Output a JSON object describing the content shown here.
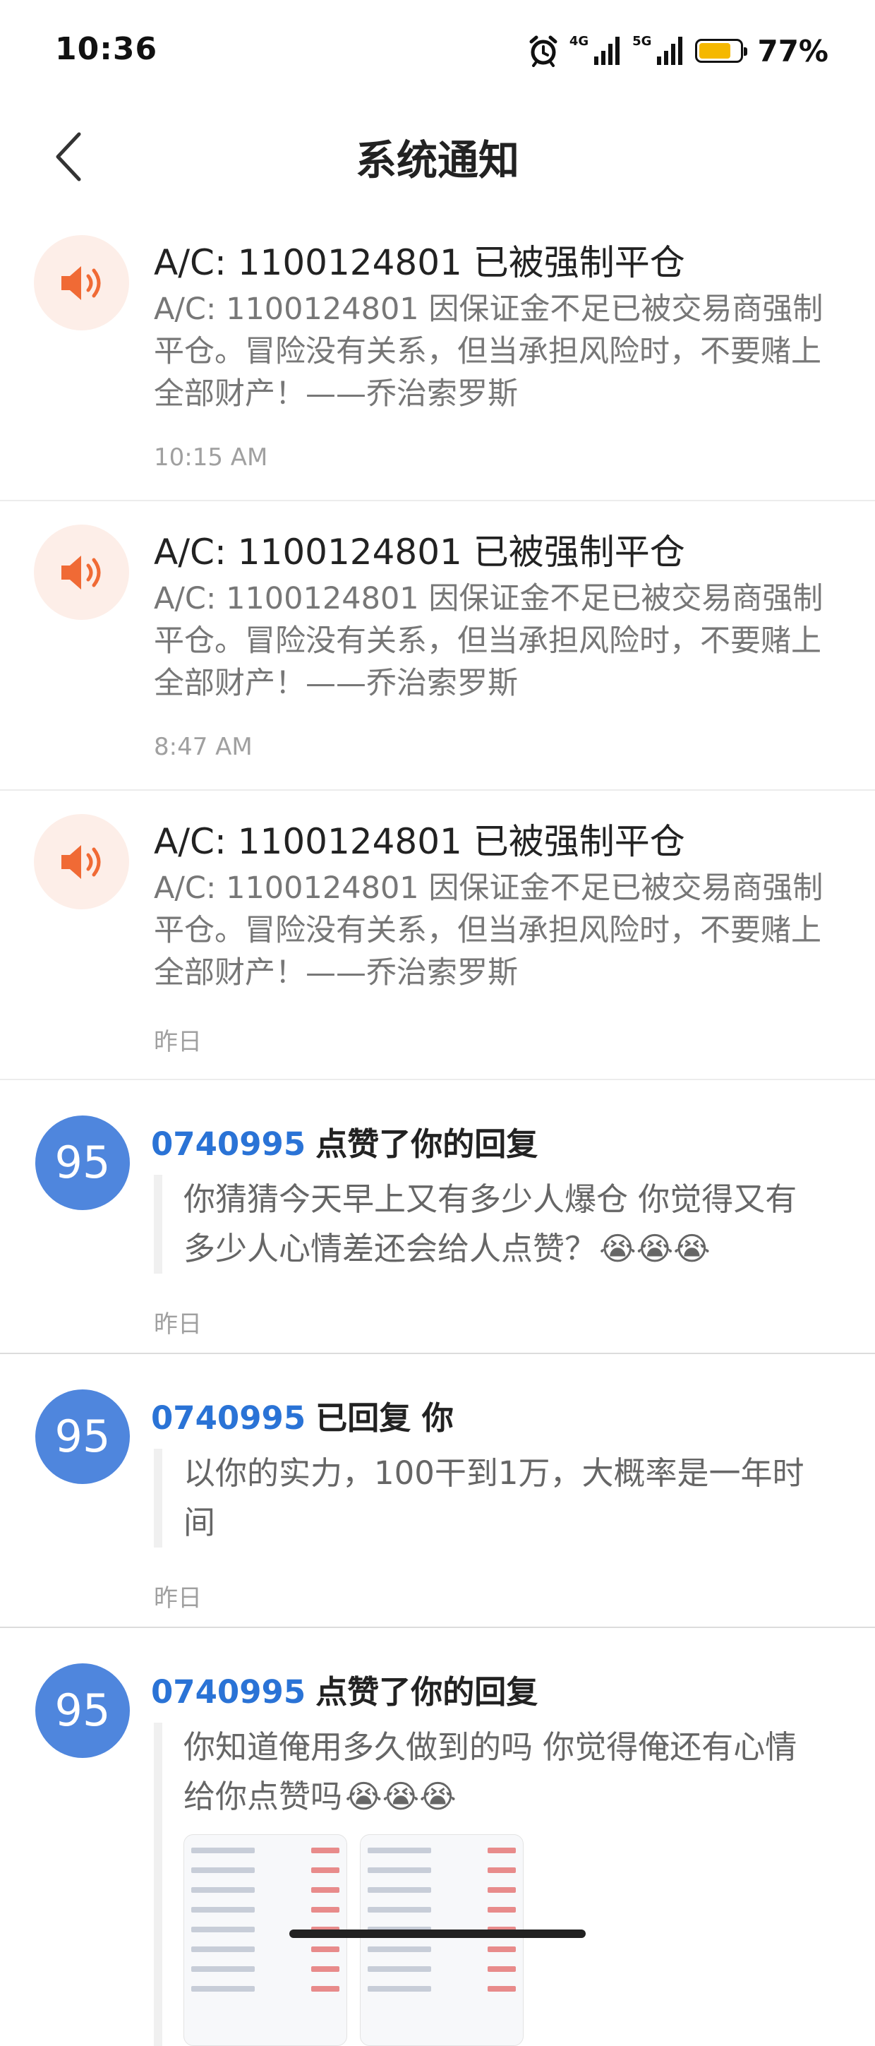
{
  "status_bar": {
    "time": "10:36",
    "net_4g": "4G",
    "net_5g": "5G",
    "battery_percent": "77%",
    "battery_level": 0.77,
    "battery_color": "#f5b800",
    "icons": [
      "alarm-icon",
      "signal-4g-icon",
      "signal-5g-icon",
      "battery-icon"
    ]
  },
  "header": {
    "back_icon": "chevron-left-icon",
    "title": "系统通知"
  },
  "notices": [
    {
      "icon": "speaker-icon",
      "title": "A/C: 1100124801 已被强制平仓",
      "body": "A/C: 1100124801 因保证金不足已被交易商强制平仓。冒险没有关系，但当承担风险时，不要赌上全部财产！——乔治索罗斯",
      "time": "10:15 AM"
    },
    {
      "icon": "speaker-icon",
      "title": "A/C: 1100124801 已被强制平仓",
      "body": "A/C: 1100124801 因保证金不足已被交易商强制平仓。冒险没有关系，但当承担风险时，不要赌上全部财产！——乔治索罗斯",
      "time": "8:47 AM"
    },
    {
      "icon": "speaker-icon",
      "title": "A/C: 1100124801 已被强制平仓",
      "body": "A/C: 1100124801 因保证金不足已被交易商强制平仓。冒险没有关系，但当承担风险时，不要赌上全部财产！——乔治索罗斯",
      "time": "昨日"
    }
  ],
  "replies": [
    {
      "avatar_text": "95",
      "user": "0740995",
      "action": "点赞了你的回复",
      "quote": "你猜猜今天早上又有多少人爆仓 你觉得又有多少人心情差还会给人点赞？",
      "emoji": "😭😭😭",
      "time": "昨日"
    },
    {
      "avatar_text": "95",
      "user": "0740995",
      "action": "已回复 你",
      "quote": "以你的实力，100干到1万，大概率是一年时间",
      "emoji": "",
      "time": "昨日"
    },
    {
      "avatar_text": "95",
      "user": "0740995",
      "action": "点赞了你的回复",
      "quote": "你知道俺用多久做到的吗 你觉得俺还有心情给你点赞吗",
      "emoji": "😭😭😭",
      "time": ""
    }
  ],
  "colors": {
    "avatar": "#4f86dd",
    "user_link": "#2a73d6",
    "notice_icon_bg": "#fdeee8",
    "speaker": "#f06a35"
  }
}
